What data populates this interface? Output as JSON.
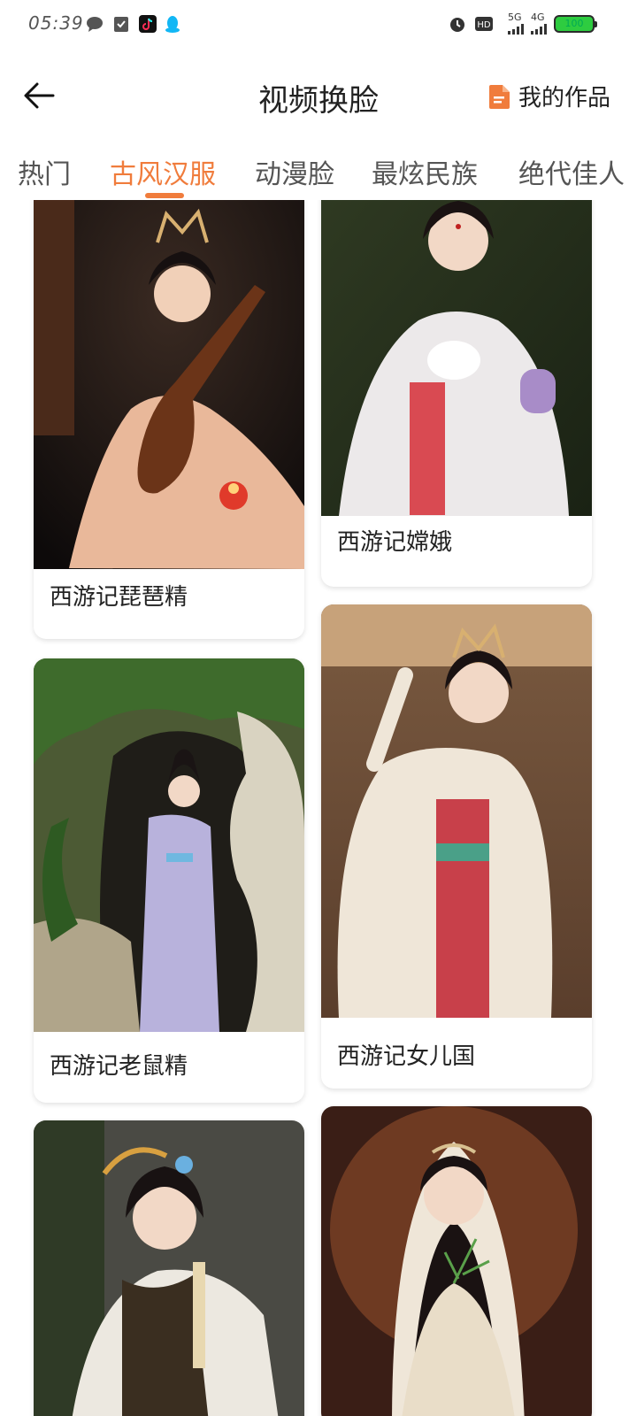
{
  "status_bar": {
    "time": "05:39",
    "network_1": "5G",
    "network_2": "4G",
    "battery": "100"
  },
  "header": {
    "title": "视频换脸",
    "my_works_label": "我的作品"
  },
  "tabs": [
    {
      "label": "热门"
    },
    {
      "label": "古风汉服"
    },
    {
      "label": "动漫脸"
    },
    {
      "label": "最炫民族"
    },
    {
      "label": "绝代佳人"
    }
  ],
  "active_tab": "古风汉服",
  "cards": [
    {
      "title": "西游记琵琶精"
    },
    {
      "title": "西游记嫦娥"
    },
    {
      "title": "西游记老鼠精"
    },
    {
      "title": "西游记女儿国"
    },
    {
      "title": ""
    },
    {
      "title": ""
    }
  ],
  "colors": {
    "accent": "#f07c3c",
    "battery": "#2ecc40"
  }
}
